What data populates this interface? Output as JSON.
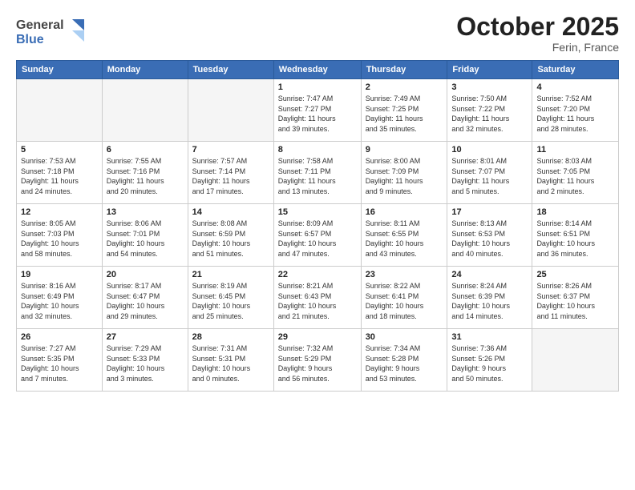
{
  "header": {
    "logo_line1": "General",
    "logo_line2": "Blue",
    "month": "October 2025",
    "location": "Ferin, France"
  },
  "weekdays": [
    "Sunday",
    "Monday",
    "Tuesday",
    "Wednesday",
    "Thursday",
    "Friday",
    "Saturday"
  ],
  "weeks": [
    [
      {
        "day": "",
        "info": "",
        "empty": true
      },
      {
        "day": "",
        "info": "",
        "empty": true
      },
      {
        "day": "",
        "info": "",
        "empty": true
      },
      {
        "day": "1",
        "info": "Sunrise: 7:47 AM\nSunset: 7:27 PM\nDaylight: 11 hours\nand 39 minutes."
      },
      {
        "day": "2",
        "info": "Sunrise: 7:49 AM\nSunset: 7:25 PM\nDaylight: 11 hours\nand 35 minutes."
      },
      {
        "day": "3",
        "info": "Sunrise: 7:50 AM\nSunset: 7:22 PM\nDaylight: 11 hours\nand 32 minutes."
      },
      {
        "day": "4",
        "info": "Sunrise: 7:52 AM\nSunset: 7:20 PM\nDaylight: 11 hours\nand 28 minutes."
      }
    ],
    [
      {
        "day": "5",
        "info": "Sunrise: 7:53 AM\nSunset: 7:18 PM\nDaylight: 11 hours\nand 24 minutes."
      },
      {
        "day": "6",
        "info": "Sunrise: 7:55 AM\nSunset: 7:16 PM\nDaylight: 11 hours\nand 20 minutes."
      },
      {
        "day": "7",
        "info": "Sunrise: 7:57 AM\nSunset: 7:14 PM\nDaylight: 11 hours\nand 17 minutes."
      },
      {
        "day": "8",
        "info": "Sunrise: 7:58 AM\nSunset: 7:11 PM\nDaylight: 11 hours\nand 13 minutes."
      },
      {
        "day": "9",
        "info": "Sunrise: 8:00 AM\nSunset: 7:09 PM\nDaylight: 11 hours\nand 9 minutes."
      },
      {
        "day": "10",
        "info": "Sunrise: 8:01 AM\nSunset: 7:07 PM\nDaylight: 11 hours\nand 5 minutes."
      },
      {
        "day": "11",
        "info": "Sunrise: 8:03 AM\nSunset: 7:05 PM\nDaylight: 11 hours\nand 2 minutes."
      }
    ],
    [
      {
        "day": "12",
        "info": "Sunrise: 8:05 AM\nSunset: 7:03 PM\nDaylight: 10 hours\nand 58 minutes."
      },
      {
        "day": "13",
        "info": "Sunrise: 8:06 AM\nSunset: 7:01 PM\nDaylight: 10 hours\nand 54 minutes."
      },
      {
        "day": "14",
        "info": "Sunrise: 8:08 AM\nSunset: 6:59 PM\nDaylight: 10 hours\nand 51 minutes."
      },
      {
        "day": "15",
        "info": "Sunrise: 8:09 AM\nSunset: 6:57 PM\nDaylight: 10 hours\nand 47 minutes."
      },
      {
        "day": "16",
        "info": "Sunrise: 8:11 AM\nSunset: 6:55 PM\nDaylight: 10 hours\nand 43 minutes."
      },
      {
        "day": "17",
        "info": "Sunrise: 8:13 AM\nSunset: 6:53 PM\nDaylight: 10 hours\nand 40 minutes."
      },
      {
        "day": "18",
        "info": "Sunrise: 8:14 AM\nSunset: 6:51 PM\nDaylight: 10 hours\nand 36 minutes."
      }
    ],
    [
      {
        "day": "19",
        "info": "Sunrise: 8:16 AM\nSunset: 6:49 PM\nDaylight: 10 hours\nand 32 minutes."
      },
      {
        "day": "20",
        "info": "Sunrise: 8:17 AM\nSunset: 6:47 PM\nDaylight: 10 hours\nand 29 minutes."
      },
      {
        "day": "21",
        "info": "Sunrise: 8:19 AM\nSunset: 6:45 PM\nDaylight: 10 hours\nand 25 minutes."
      },
      {
        "day": "22",
        "info": "Sunrise: 8:21 AM\nSunset: 6:43 PM\nDaylight: 10 hours\nand 21 minutes."
      },
      {
        "day": "23",
        "info": "Sunrise: 8:22 AM\nSunset: 6:41 PM\nDaylight: 10 hours\nand 18 minutes."
      },
      {
        "day": "24",
        "info": "Sunrise: 8:24 AM\nSunset: 6:39 PM\nDaylight: 10 hours\nand 14 minutes."
      },
      {
        "day": "25",
        "info": "Sunrise: 8:26 AM\nSunset: 6:37 PM\nDaylight: 10 hours\nand 11 minutes."
      }
    ],
    [
      {
        "day": "26",
        "info": "Sunrise: 7:27 AM\nSunset: 5:35 PM\nDaylight: 10 hours\nand 7 minutes."
      },
      {
        "day": "27",
        "info": "Sunrise: 7:29 AM\nSunset: 5:33 PM\nDaylight: 10 hours\nand 3 minutes."
      },
      {
        "day": "28",
        "info": "Sunrise: 7:31 AM\nSunset: 5:31 PM\nDaylight: 10 hours\nand 0 minutes."
      },
      {
        "day": "29",
        "info": "Sunrise: 7:32 AM\nSunset: 5:29 PM\nDaylight: 9 hours\nand 56 minutes."
      },
      {
        "day": "30",
        "info": "Sunrise: 7:34 AM\nSunset: 5:28 PM\nDaylight: 9 hours\nand 53 minutes."
      },
      {
        "day": "31",
        "info": "Sunrise: 7:36 AM\nSunset: 5:26 PM\nDaylight: 9 hours\nand 50 minutes."
      },
      {
        "day": "",
        "info": "",
        "empty": true
      }
    ]
  ]
}
